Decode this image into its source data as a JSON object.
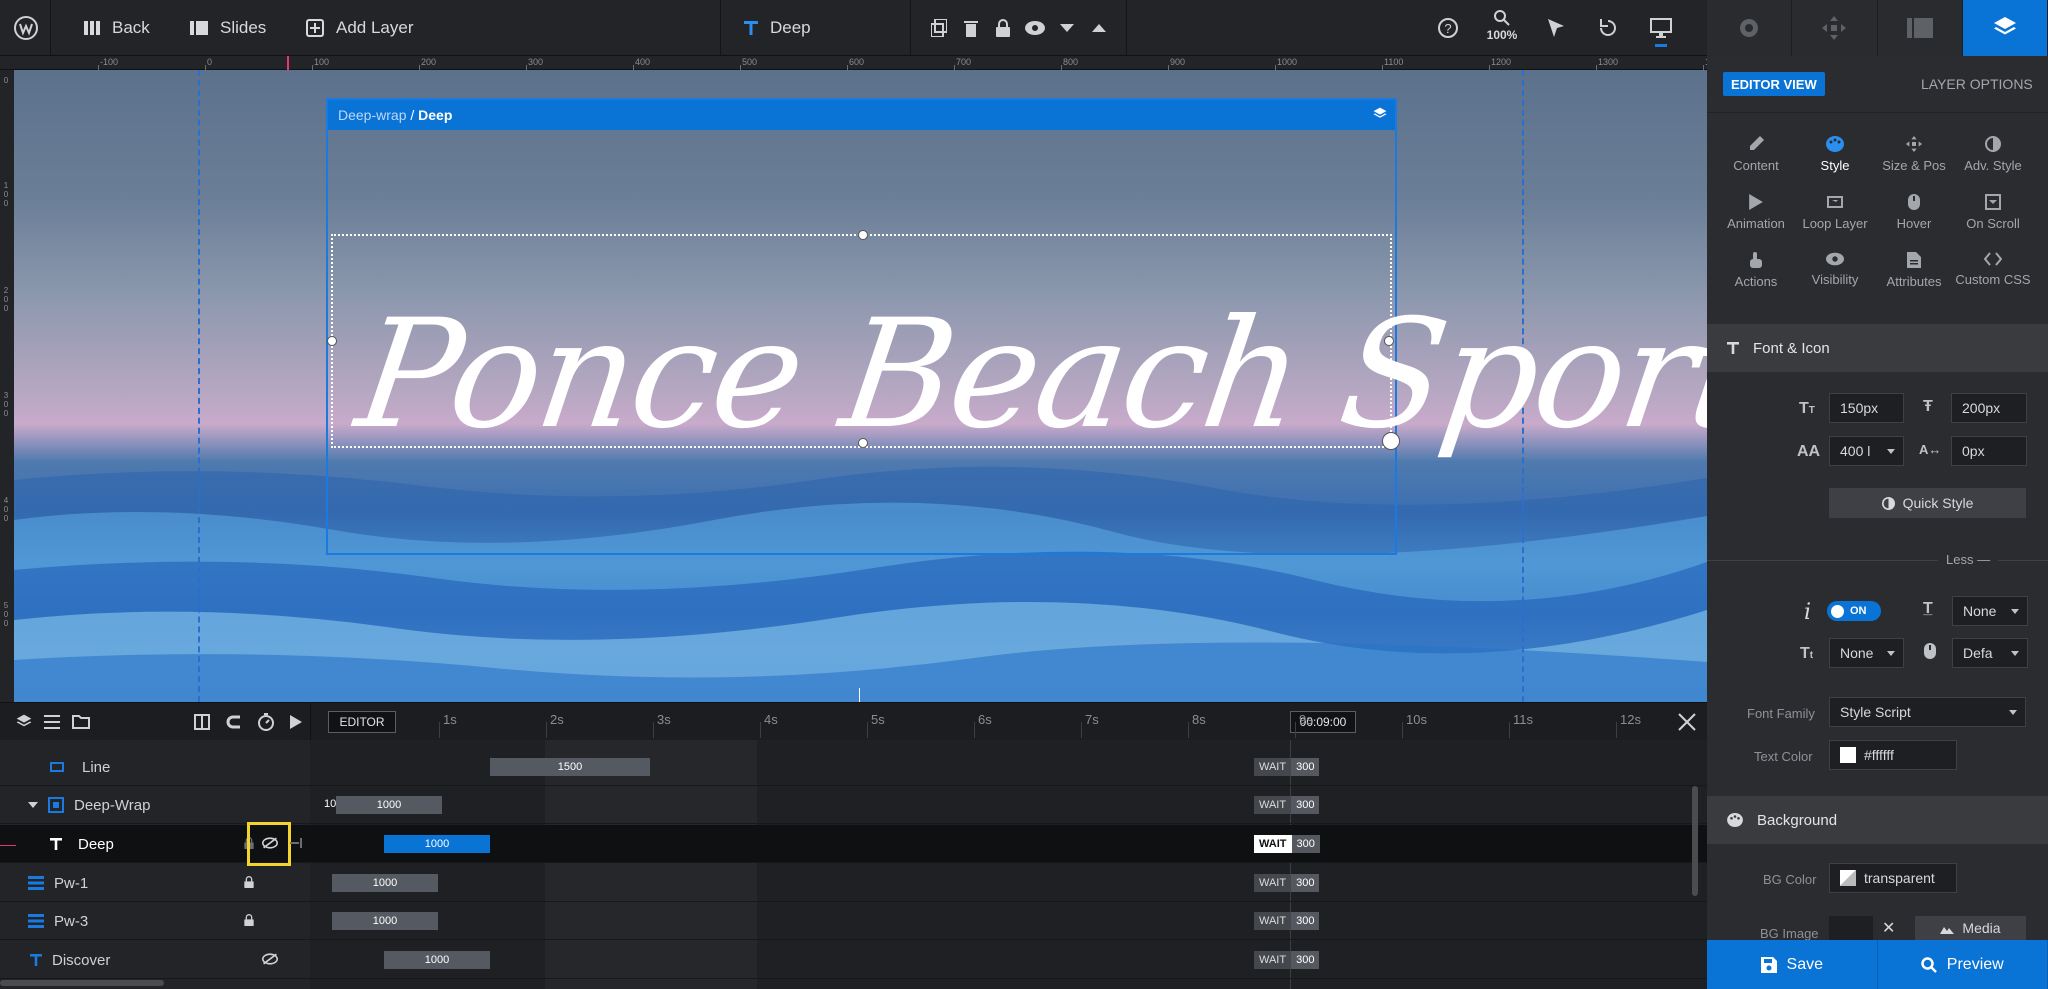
{
  "topbar": {
    "back": "Back",
    "slides": "Slides",
    "add_layer": "Add Layer",
    "layer_name": "Deep",
    "zoom": "100%"
  },
  "ruler": {
    "h_labels": [
      "-100",
      "0",
      "100",
      "200",
      "300",
      "400",
      "500",
      "600",
      "700",
      "800",
      "900",
      "1000",
      "1100",
      "1200",
      "1300",
      "14"
    ],
    "v_labels": [
      "0",
      "100",
      "200",
      "300",
      "400",
      "500"
    ]
  },
  "canvas": {
    "breadcrumb_parent": "Deep-wrap",
    "breadcrumb_sep": " / ",
    "breadcrumb_current": "Deep",
    "headline": "Ponce Beach Sports"
  },
  "timeline": {
    "editor_label": "EDITOR",
    "seconds": [
      "1s",
      "2s",
      "3s",
      "4s",
      "5s",
      "6s",
      "7s",
      "8s",
      "9s",
      "10s",
      "11s",
      "12s"
    ],
    "time_badge": "00:09:00",
    "wait_label": "WAIT",
    "rows": [
      {
        "name": "Line",
        "bar": "1500",
        "wait": "300"
      },
      {
        "name": "Deep-Wrap",
        "prefix": "10",
        "bar": "1000",
        "wait": "300"
      },
      {
        "name": "Deep",
        "bar": "1000",
        "wait": "300"
      },
      {
        "name": "Pw-1",
        "bar": "1000",
        "wait": "300"
      },
      {
        "name": "Pw-3",
        "bar": "1000",
        "wait": "300"
      },
      {
        "name": "Discover",
        "bar": "1000",
        "wait": "300"
      }
    ]
  },
  "panel": {
    "editor_view": "EDITOR VIEW",
    "layer_options": "LAYER OPTIONS",
    "options": [
      "Content",
      "Style",
      "Size & Pos",
      "Adv. Style",
      "Animation",
      "Loop Layer",
      "Hover",
      "On Scroll",
      "Actions",
      "Visibility",
      "Attributes",
      "Custom CSS"
    ],
    "font_icon": {
      "title": "Font & Icon",
      "font_size": "150px",
      "line_height": "200px",
      "font_weight": "400 l",
      "letter_spacing": "0px",
      "quick_style": "Quick Style",
      "less": "Less",
      "italic_toggle": "ON",
      "text_transform": "None",
      "text_decoration": "None",
      "cursor": "Defa",
      "font_family_label": "Font Family",
      "font_family": "Style Script",
      "text_color_label": "Text Color",
      "text_color": "#ffffff"
    },
    "background": {
      "title": "Background",
      "bg_color_label": "BG Color",
      "bg_color": "transparent",
      "bg_image_label": "BG Image",
      "media": "Media"
    },
    "save": "Save",
    "preview": "Preview"
  },
  "colors": {
    "accent": "#0a73d6",
    "highlight": "#f2d330"
  }
}
